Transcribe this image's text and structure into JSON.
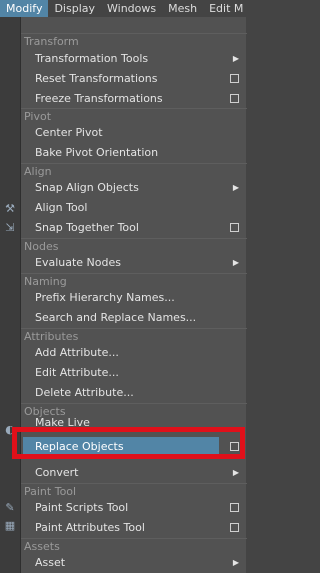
{
  "menubar": {
    "items": [
      {
        "label": "Modify",
        "active": true
      },
      {
        "label": "Display",
        "active": false
      },
      {
        "label": "Windows",
        "active": false
      },
      {
        "label": "Mesh",
        "active": false
      },
      {
        "label": "Edit M",
        "active": false
      }
    ]
  },
  "menu": {
    "sections": {
      "transform": "Transform",
      "pivot": "Pivot",
      "align": "Align",
      "nodes": "Nodes",
      "naming": "Naming",
      "attributes": "Attributes",
      "objects": "Objects",
      "paint_tool": "Paint Tool",
      "assets": "Assets"
    },
    "items": {
      "transformation_tools": "Transformation Tools",
      "reset_transformations": "Reset Transformations",
      "freeze_transformations": "Freeze Transformations",
      "center_pivot": "Center Pivot",
      "bake_pivot_orientation": "Bake Pivot Orientation",
      "snap_align_objects": "Snap Align Objects",
      "align_tool": "Align Tool",
      "snap_together_tool": "Snap Together Tool",
      "evaluate_nodes": "Evaluate Nodes",
      "prefix_hierarchy_names": "Prefix Hierarchy Names...",
      "search_replace_names": "Search and Replace Names...",
      "add_attribute": "Add Attribute...",
      "edit_attribute": "Edit Attribute...",
      "delete_attribute": "Delete Attribute...",
      "make_live": "Make Live",
      "replace_objects": "Replace Objects",
      "convert": "Convert",
      "paint_scripts_tool": "Paint Scripts Tool",
      "paint_attributes_tool": "Paint Attributes Tool",
      "asset": "Asset"
    }
  },
  "colors": {
    "highlight": "#5285a6",
    "menu_bg": "#525252",
    "annotation": "#e0101a"
  }
}
